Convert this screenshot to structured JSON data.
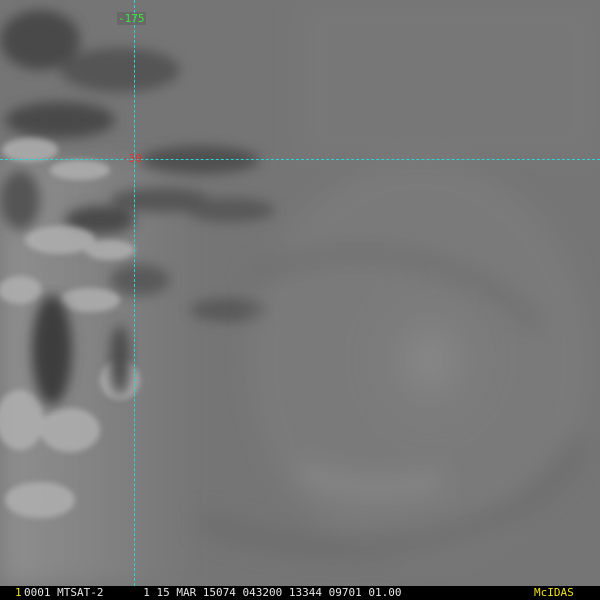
{
  "overlay": {
    "longitude_label": "-175",
    "latitude_label": "-30",
    "grid_color": "#2ad6d6",
    "longitude_label_color": "#3ee63e",
    "latitude_label_color": "#e03030"
  },
  "status_bar": {
    "frame_number": "1",
    "text": "0001 MTSAT-2      1 15 MAR 15074 043200 13344 09701 01.00",
    "software": "McIDAS",
    "highlight_color": "#f0e020"
  }
}
